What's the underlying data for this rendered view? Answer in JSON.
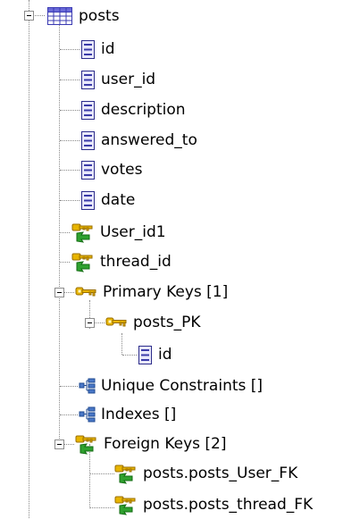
{
  "tree": {
    "table": {
      "label": "posts"
    },
    "columns": [
      {
        "label": "id"
      },
      {
        "label": "user_id"
      },
      {
        "label": "description"
      },
      {
        "label": "answered_to"
      },
      {
        "label": "votes"
      },
      {
        "label": "date"
      }
    ],
    "fk_columns": [
      {
        "label": "User_id1"
      },
      {
        "label": "thread_id"
      }
    ],
    "primary_keys": {
      "label": "Primary Keys [1]",
      "key": {
        "label": "posts_PK",
        "columns": [
          {
            "label": "id"
          }
        ]
      }
    },
    "unique_constraints": {
      "label": "Unique Constraints []"
    },
    "indexes": {
      "label": "Indexes []"
    },
    "foreign_keys": {
      "label": "Foreign Keys [2]",
      "items": [
        {
          "label": "posts.posts_User_FK"
        },
        {
          "label": "posts.posts_thread_FK"
        }
      ]
    }
  },
  "icons": {
    "table": "table-grid-icon",
    "column": "column-icon",
    "foreign_key": "foreign-key-icon",
    "primary_key": "primary-key-icon",
    "index": "index-icon"
  }
}
